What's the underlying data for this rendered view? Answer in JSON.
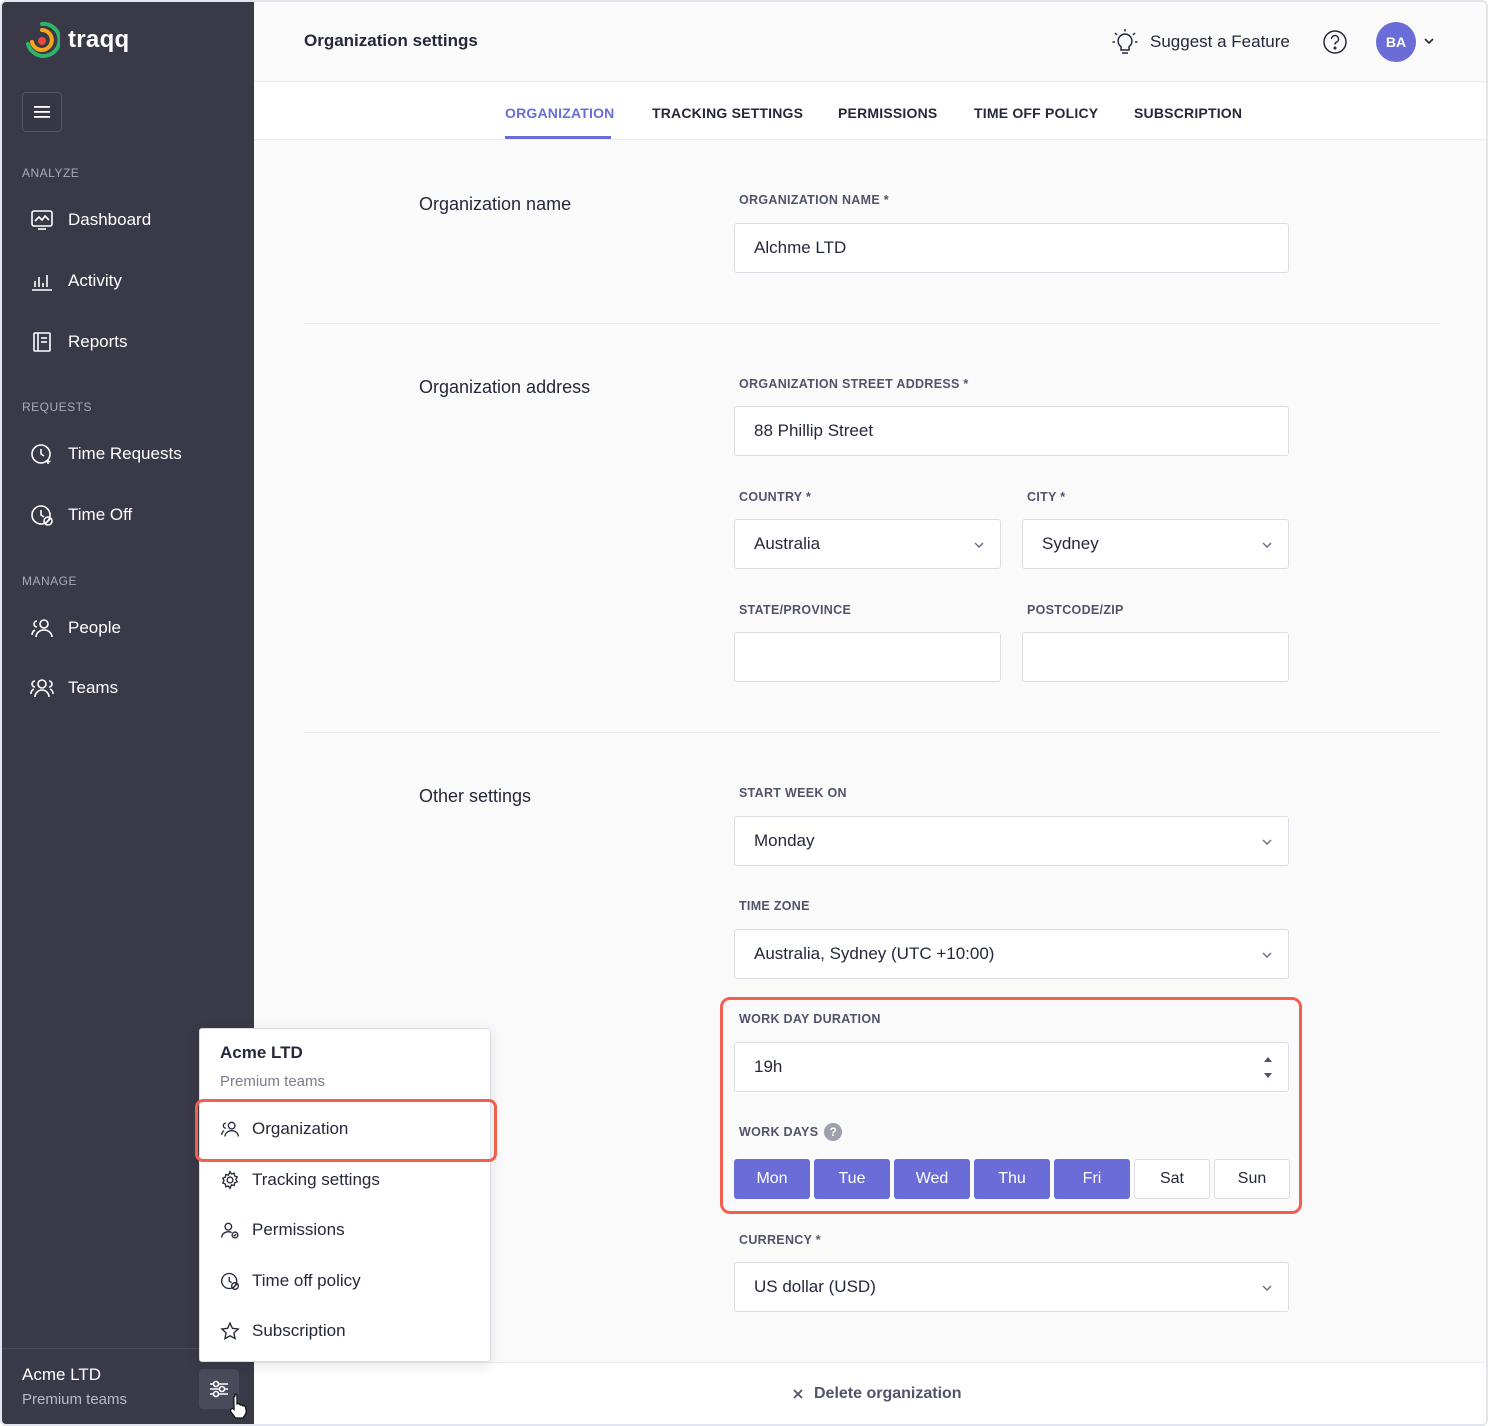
{
  "app": {
    "name": "traqq"
  },
  "sidebar": {
    "sections": [
      {
        "label": "ANALYZE",
        "items": [
          {
            "label": "Dashboard",
            "icon": "dashboard-icon"
          },
          {
            "label": "Activity",
            "icon": "activity-icon"
          },
          {
            "label": "Reports",
            "icon": "reports-icon"
          }
        ]
      },
      {
        "label": "REQUESTS",
        "items": [
          {
            "label": "Time Requests",
            "icon": "time-requests-icon"
          },
          {
            "label": "Time Off",
            "icon": "time-off-icon"
          }
        ]
      },
      {
        "label": "MANAGE",
        "items": [
          {
            "label": "People",
            "icon": "people-icon"
          },
          {
            "label": "Teams",
            "icon": "teams-icon"
          }
        ]
      }
    ],
    "footer": {
      "org_name": "Acme LTD",
      "plan": "Premium teams"
    }
  },
  "header": {
    "title": "Organization settings",
    "suggest_label": "Suggest a Feature",
    "avatar_initials": "BA"
  },
  "tabs": [
    {
      "label": "ORGANIZATION",
      "active": true
    },
    {
      "label": "TRACKING SETTINGS",
      "active": false
    },
    {
      "label": "PERMISSIONS",
      "active": false
    },
    {
      "label": "TIME OFF POLICY",
      "active": false
    },
    {
      "label": "SUBSCRIPTION",
      "active": false
    }
  ],
  "form": {
    "org_name_section": "Organization name",
    "org_name_label": "ORGANIZATION NAME *",
    "org_name_value": "Alchme LTD",
    "address_section": "Organization address",
    "street_label": "ORGANIZATION STREET ADDRESS *",
    "street_value": "88 Phillip Street",
    "country_label": "COUNTRY *",
    "country_value": "Australia",
    "city_label": "CITY *",
    "city_value": "Sydney",
    "state_label": "STATE/PROVINCE",
    "state_value": "",
    "postcode_label": "POSTCODE/ZIP",
    "postcode_value": "",
    "other_section": "Other settings",
    "start_week_label": "START WEEK ON",
    "start_week_value": "Monday",
    "timezone_label": "TIME ZONE",
    "timezone_value": "Australia, Sydney (UTC +10:00)",
    "workday_label": "WORK DAY DURATION",
    "workday_value": "19h",
    "workdays_label": "WORK DAYS",
    "workdays_info": "?",
    "days": [
      {
        "label": "Mon",
        "selected": true
      },
      {
        "label": "Tue",
        "selected": true
      },
      {
        "label": "Wed",
        "selected": true
      },
      {
        "label": "Thu",
        "selected": true
      },
      {
        "label": "Fri",
        "selected": true
      },
      {
        "label": "Sat",
        "selected": false
      },
      {
        "label": "Sun",
        "selected": false
      }
    ],
    "currency_label": "CURRENCY *",
    "currency_value": "US dollar (USD)"
  },
  "bottom": {
    "delete_label": "Delete organization"
  },
  "popup": {
    "title": "Acme LTD",
    "subtitle": "Premium teams",
    "items": [
      {
        "label": "Organization",
        "icon": "organization-icon"
      },
      {
        "label": "Tracking settings",
        "icon": "gear-icon"
      },
      {
        "label": "Permissions",
        "icon": "permissions-icon"
      },
      {
        "label": "Time off policy",
        "icon": "time-off-policy-icon"
      },
      {
        "label": "Subscription",
        "icon": "star-icon"
      }
    ]
  },
  "colors": {
    "accent": "#6a6cd8",
    "sidebar_bg": "#393948",
    "highlight": "#f1604f"
  }
}
